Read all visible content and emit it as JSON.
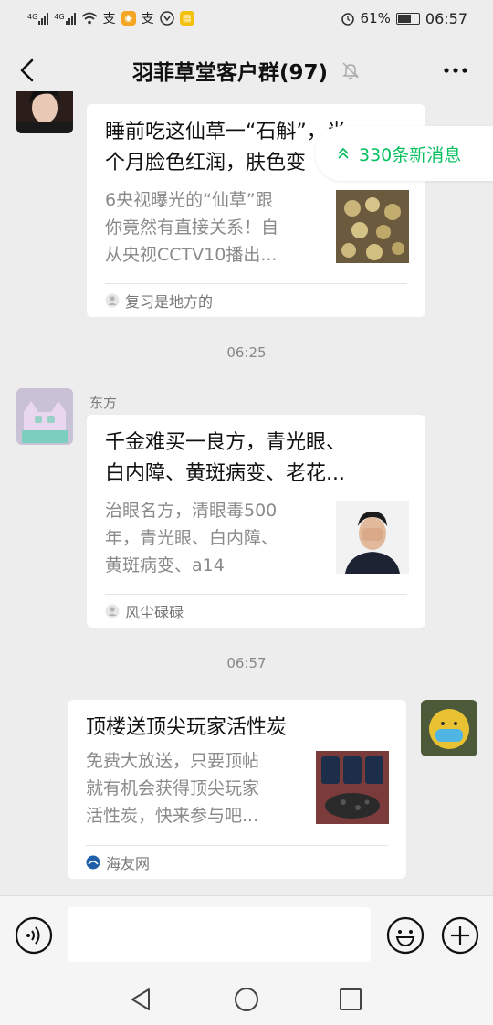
{
  "status_bar": {
    "signal1": "4G",
    "signal2": "4G",
    "battery": "61%",
    "time": "06:57"
  },
  "header": {
    "title": "羽菲草堂客户群(97)"
  },
  "new_messages": {
    "label": "330条新消息"
  },
  "messages": [
    {
      "type": "card",
      "side": "left",
      "title": "睡前吃这仙草一“石斛”，半个月脸色红润，肤色变白",
      "title_line1": "睡前吃这仙草一“石斛”，半",
      "title_line2": "个月脸色红润，肤色变",
      "desc_line1": "6央视曝光的“仙草”跟",
      "desc_line2": "你竟然有直接关系！自",
      "desc_line3": "从央视CCTV10播出...",
      "source": "复习是地方的"
    },
    {
      "type": "time",
      "text": "06:25"
    },
    {
      "type": "card",
      "side": "left",
      "sender": "东方",
      "title_line1": "千金难买一良方，青光眼、",
      "title_line2": "白内障、黄斑病变、老花...",
      "desc_line1": "治眼名方，清眼毒500",
      "desc_line2": "年，青光眼、白内障、",
      "desc_line3": "黄斑病变、a14",
      "source": "风尘碌碌"
    },
    {
      "type": "time",
      "text": "06:57"
    },
    {
      "type": "card",
      "side": "right",
      "title_line1": "顶楼送顶尖玩家活性炭",
      "desc_line1": "免费大放送，只要顶帖",
      "desc_line2": "就有机会获得顶尖玩家",
      "desc_line3": "活性炭，快来参与吧...",
      "source": "海友网"
    }
  ],
  "input_bar": {
    "placeholder": ""
  },
  "colors": {
    "accent_green": "#07c160",
    "background": "#ededed"
  },
  "icons": {
    "back": "back-arrow-icon",
    "mute": "bell-muted-icon",
    "more": "more-dots-icon",
    "voice": "voice-icon",
    "emoji": "emoji-icon",
    "plus": "plus-icon"
  }
}
